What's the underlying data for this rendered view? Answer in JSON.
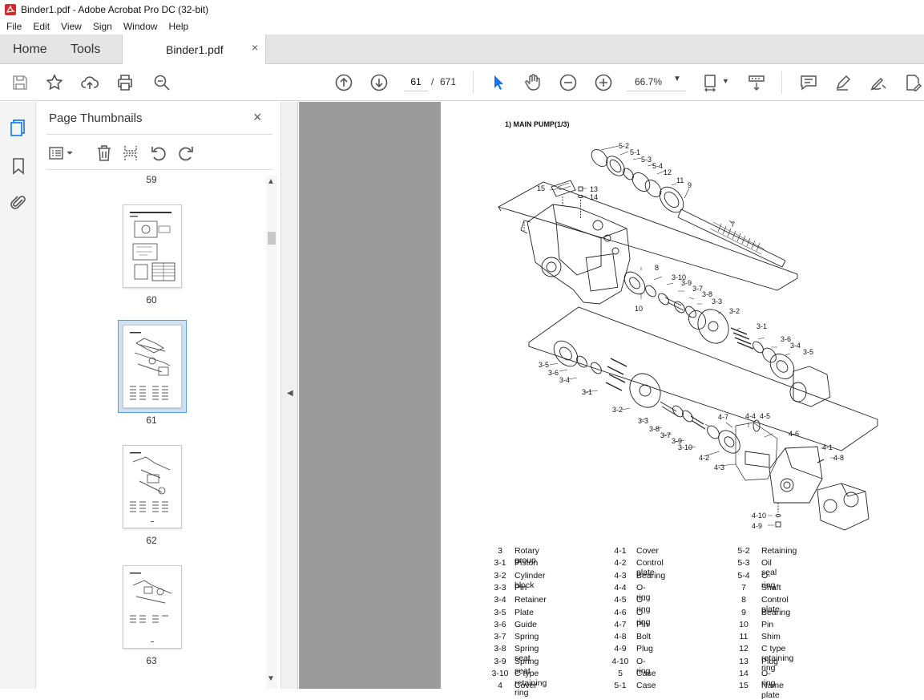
{
  "window": {
    "title": "Binder1.pdf - Adobe Acrobat Pro DC (32-bit)"
  },
  "menu": [
    "File",
    "Edit",
    "View",
    "Sign",
    "Window",
    "Help"
  ],
  "tabs": {
    "home": "Home",
    "tools": "Tools",
    "document": "Binder1.pdf",
    "close": "×"
  },
  "toolbar": {
    "current_page": "61",
    "separator": "/",
    "total_pages": "671",
    "zoom": "66.7%"
  },
  "thumbnails_panel": {
    "title": "Page Thumbnails",
    "close": "×",
    "pages": [
      {
        "label": "59"
      },
      {
        "label": "60"
      },
      {
        "label": "61",
        "selected": true
      },
      {
        "label": "62"
      },
      {
        "label": "63"
      }
    ]
  },
  "document": {
    "heading": "1)  MAIN PUMP(1/3)",
    "callouts": [
      "5-2",
      "5-1",
      "5-3",
      "5-4",
      "12",
      "11",
      "9",
      "15",
      "13",
      "14",
      "7",
      "8",
      "3-10",
      "3-9",
      "3-7",
      "3-8",
      "3-3",
      "3-2",
      "10",
      "3-1",
      "3-6",
      "3-4",
      "3-5",
      "3-5",
      "3-6",
      "3-4",
      "3-1",
      "3-2",
      "3-3",
      "3-8",
      "3-7",
      "3-9",
      "3-10",
      "4-7",
      "4-4",
      "4-5",
      "4-6",
      "4-2",
      "4-3",
      "4-1",
      "4-8",
      "4-10",
      "4-9"
    ],
    "parts": [
      [
        [
          "3",
          "Rotary group"
        ],
        [
          "4-1",
          "Cover"
        ],
        [
          "5-2",
          "Retaining"
        ]
      ],
      [
        [
          "3-1",
          "Piston"
        ],
        [
          "4-2",
          "Control plate"
        ],
        [
          "5-3",
          "Oil seal"
        ]
      ],
      [
        [
          "3-2",
          "Cylinder block"
        ],
        [
          "4-3",
          "Bearing"
        ],
        [
          "5-4",
          "O-ring"
        ]
      ],
      [
        [
          "3-3",
          "Pin"
        ],
        [
          "4-4",
          "O-ring"
        ],
        [
          "7",
          "Shaft"
        ]
      ],
      [
        [
          "3-4",
          "Retainer"
        ],
        [
          "4-5",
          "O-ring"
        ],
        [
          "8",
          "Control plate"
        ]
      ],
      [
        [
          "3-5",
          "Plate"
        ],
        [
          "4-6",
          "O-ring"
        ],
        [
          "9",
          "Bearing"
        ]
      ],
      [
        [
          "3-6",
          "Guide"
        ],
        [
          "4-7",
          "Pin"
        ],
        [
          "10",
          "Pin"
        ]
      ],
      [
        [
          "3-7",
          "Spring"
        ],
        [
          "4-8",
          "Bolt"
        ],
        [
          "11",
          "Shim"
        ]
      ],
      [
        [
          "3-8",
          "Spring seat"
        ],
        [
          "4-9",
          "Plug"
        ],
        [
          "12",
          "C type retaining ring"
        ]
      ],
      [
        [
          "3-9",
          "Spring seat"
        ],
        [
          "4-10",
          "O-ring"
        ],
        [
          "13",
          "Plug"
        ]
      ],
      [
        [
          "3-10",
          "C type retaining ring"
        ],
        [
          "5",
          "Case"
        ],
        [
          "14",
          "O-ring"
        ]
      ],
      [
        [
          "4",
          "Cover"
        ],
        [
          "5-1",
          "Case"
        ],
        [
          "15",
          "Name plate"
        ]
      ]
    ]
  }
}
